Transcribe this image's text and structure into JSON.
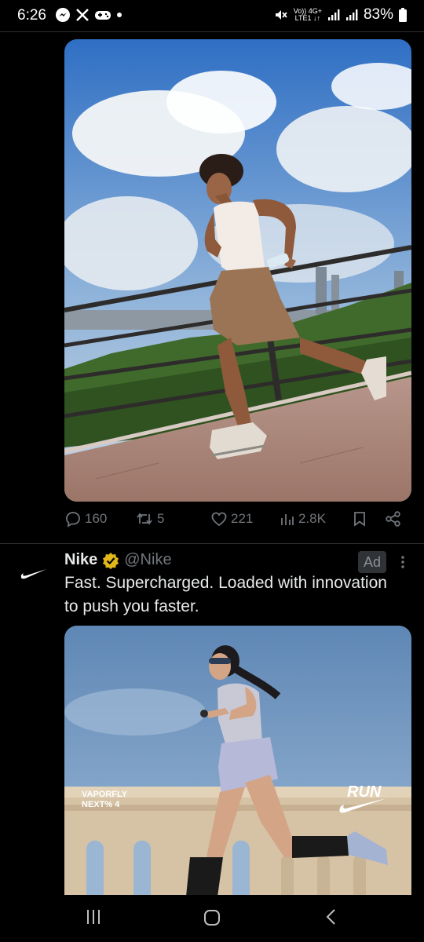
{
  "status_bar": {
    "time": "6:26",
    "network_top": "Vo)) 4G+",
    "network_bottom": "LTE1 ↓↑",
    "battery": "83%"
  },
  "post": {
    "image_alt": "Runner in tank top and shorts running along a riverside path",
    "actions": {
      "replies": "160",
      "reposts": "5",
      "likes": "221",
      "views": "2.8K"
    }
  },
  "ad": {
    "name": "Nike",
    "handle": "@Nike",
    "badge": "Ad",
    "text": "Fast. Supercharged. Loaded with innovation to push you faster.",
    "image_text_1": "VAPORFLY",
    "image_text_2": "NEXT% 4",
    "image_brand": "RUN"
  },
  "colors": {
    "accent": "#1d9bf0",
    "verified": "#e2b719",
    "muted": "#71767b"
  }
}
